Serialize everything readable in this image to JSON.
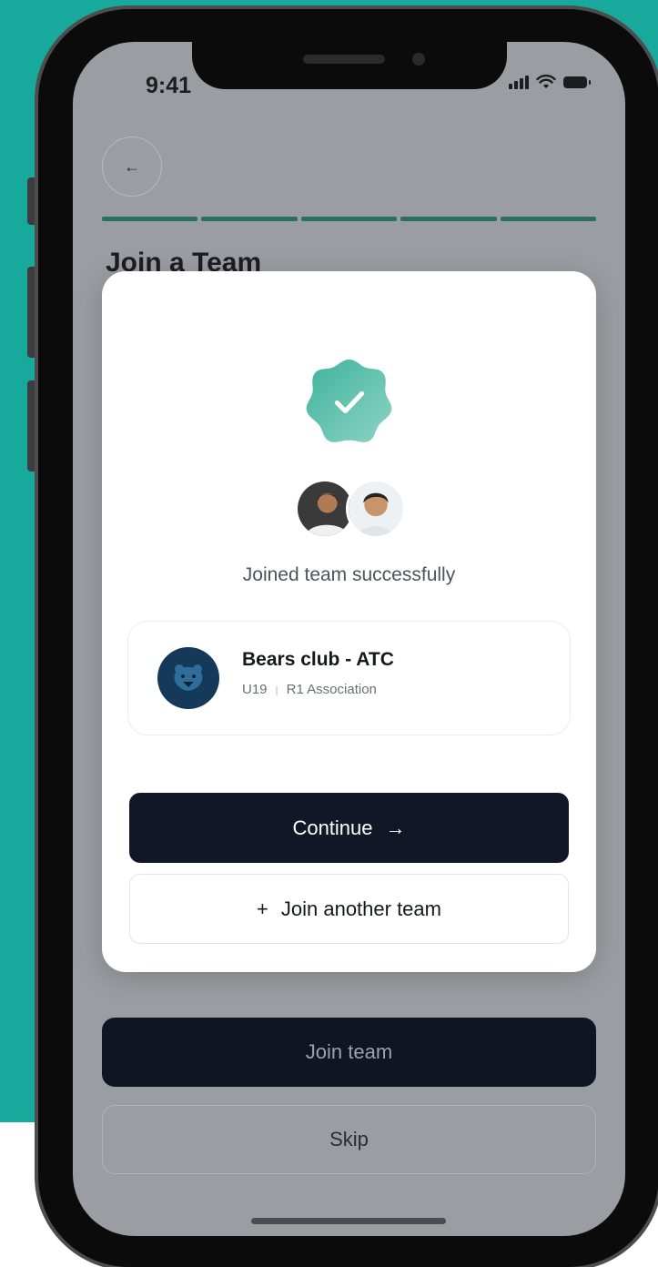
{
  "status_bar": {
    "time": "9:41"
  },
  "background_screen": {
    "title": "Join a Team",
    "join_label": "Join team",
    "skip_label": "Skip"
  },
  "modal": {
    "message": "Joined team successfully",
    "team": {
      "name": "Bears club - ATC",
      "age_group": "U19",
      "separator": "|",
      "association": "R1 Association"
    },
    "continue_label": "Continue",
    "continue_arrow": "→",
    "join_another_label": "Join another team",
    "join_another_plus": "+"
  },
  "colors": {
    "page_background": "#16a99c",
    "accent": "#5cc1ac",
    "primary_button": "#111726",
    "progress": "#2c6e66"
  },
  "icons": [
    "back-arrow-icon",
    "check-badge-icon",
    "signal-icon",
    "wifi-icon",
    "battery-icon",
    "bear-logo-icon",
    "arrow-right-icon",
    "plus-icon"
  ]
}
